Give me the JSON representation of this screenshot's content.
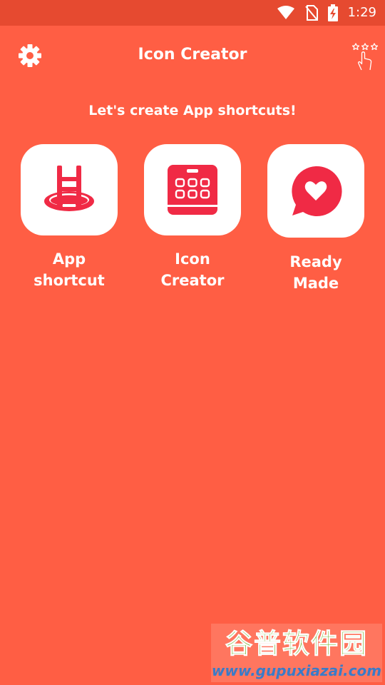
{
  "status_bar": {
    "time": "1:29",
    "icons": [
      "wifi-icon",
      "no-sim-icon",
      "battery-charging-icon"
    ]
  },
  "app_bar": {
    "title": "Icon Creator",
    "left_icon": "gear-icon",
    "right_icon": "rate-stars-hand-icon"
  },
  "subtitle": "Let's create App shortcuts!",
  "tiles": [
    {
      "label": "App\nshortcut",
      "icon": "ladder-icon"
    },
    {
      "label": "Icon\nCreator",
      "icon": "icon-grid-icon"
    },
    {
      "label": "Ready\nMade",
      "icon": "heart-chat-icon"
    }
  ],
  "watermark": {
    "main": "谷普软件园",
    "url": "www.gupuxiazai.com"
  },
  "colors": {
    "background": "#FF5E44",
    "status_bar": "#E64A30",
    "icon_red": "#F02A45",
    "tile": "#FFFFFF"
  }
}
